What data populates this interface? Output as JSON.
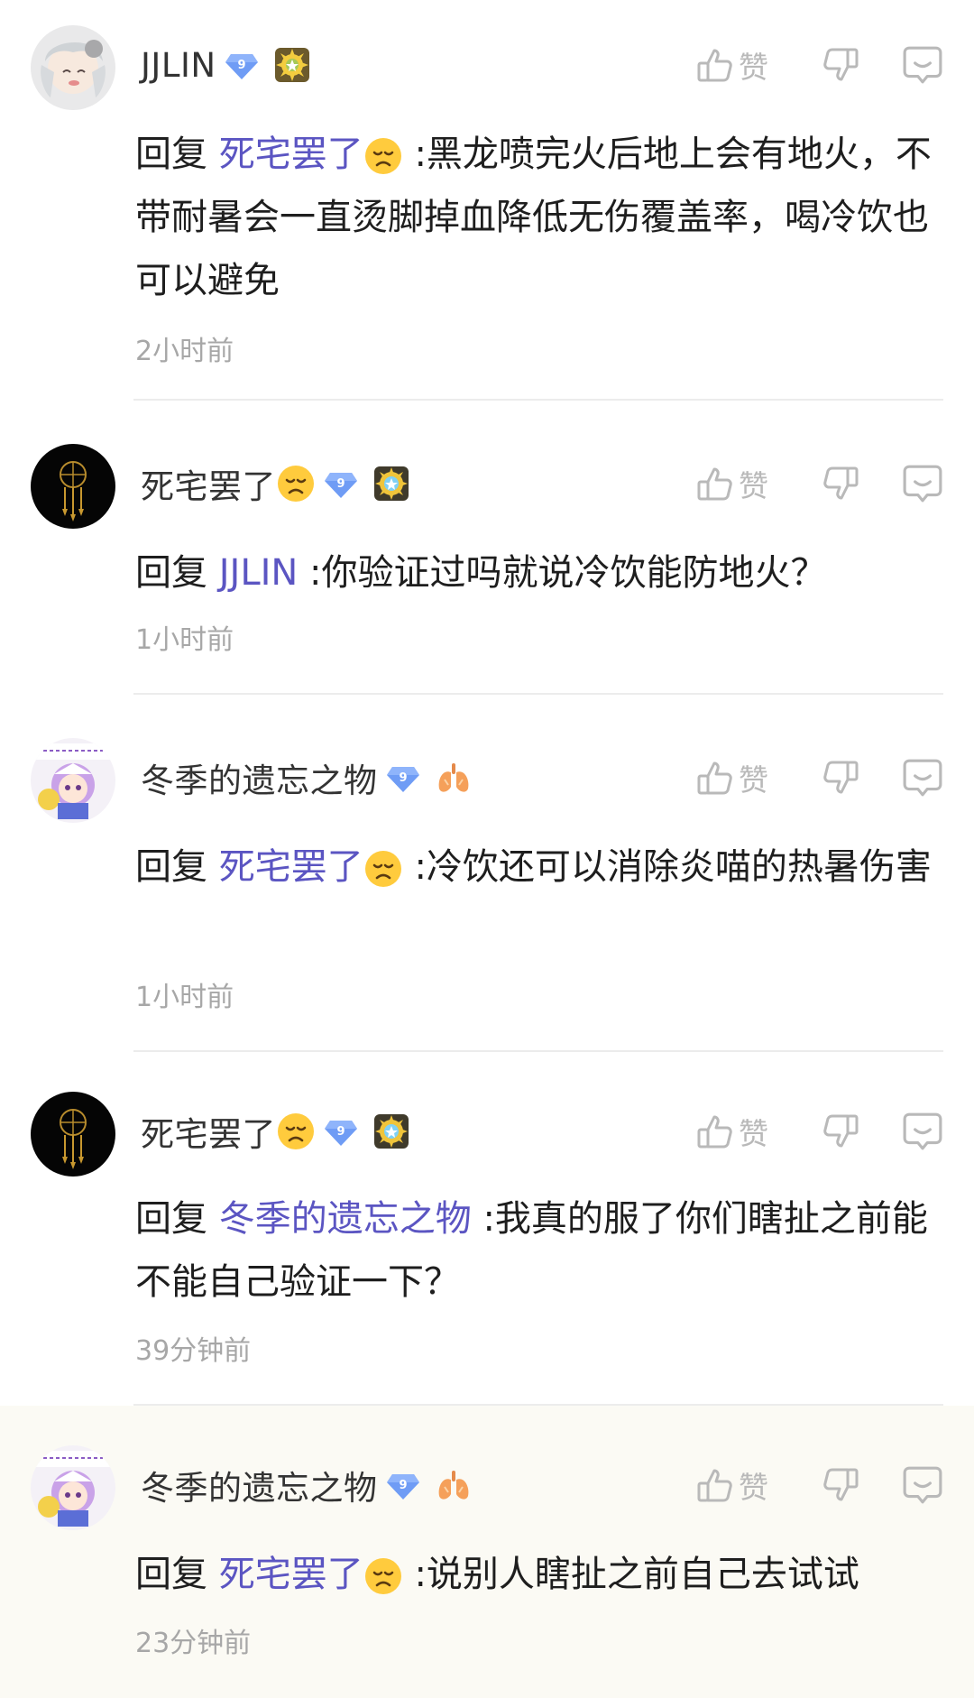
{
  "comments": [
    {
      "username": "JJLIN",
      "level": "9",
      "reply_label": "回复",
      "mention": "死宅罢了",
      "mention_has_emoji": true,
      "text": ":黑龙喷完火后地上会有地火，不带耐暑会一直烫脚掉血降低无伤覆盖率，喝冷饮也可以避免",
      "time": "2小时前",
      "like_label": "赞",
      "medal_icon": "sun-medal-icon"
    },
    {
      "username": "死宅罢了",
      "level": "9",
      "reply_label": "回复",
      "mention": "JJLIN",
      "mention_has_emoji": false,
      "text": ":你验证过吗就说冷饮能防地火？",
      "time": "1小时前",
      "like_label": "赞",
      "medal_icon": "blue-sun-medal-icon"
    },
    {
      "username": "冬季的遗忘之物",
      "level": "9",
      "reply_label": "回复",
      "mention": "死宅罢了",
      "mention_has_emoji": true,
      "text": ":冷饮还可以消除炎喵的热暑伤害",
      "time": "1小时前",
      "like_label": "赞",
      "medal_icon": "lungs-icon"
    },
    {
      "username": "死宅罢了",
      "level": "9",
      "reply_label": "回复",
      "mention": "冬季的遗忘之物",
      "mention_has_emoji": false,
      "text": ":我真的服了你们瞎扯之前能不能自己验证一下？",
      "time": "39分钟前",
      "like_label": "赞",
      "medal_icon": "blue-sun-medal-icon"
    },
    {
      "username": "冬季的遗忘之物",
      "level": "9",
      "reply_label": "回复",
      "mention": "死宅罢了",
      "mention_has_emoji": true,
      "text": ":说别人瞎扯之前自己去试试",
      "time": "23分钟前",
      "like_label": "赞",
      "medal_icon": "lungs-icon"
    }
  ],
  "colors": {
    "mention": "#5b55c2",
    "icon_gray": "#b9b9b9",
    "time_gray": "#a7a7a7",
    "level_badge": "#6f9cf5",
    "highlight_bg": "#fbfaf4"
  },
  "icons": {
    "sad_emoji": "sad-face-emoji",
    "thumb_up": "thumb-up-icon",
    "thumb_down": "thumb-down-icon",
    "reply": "comment-bubble-icon"
  }
}
